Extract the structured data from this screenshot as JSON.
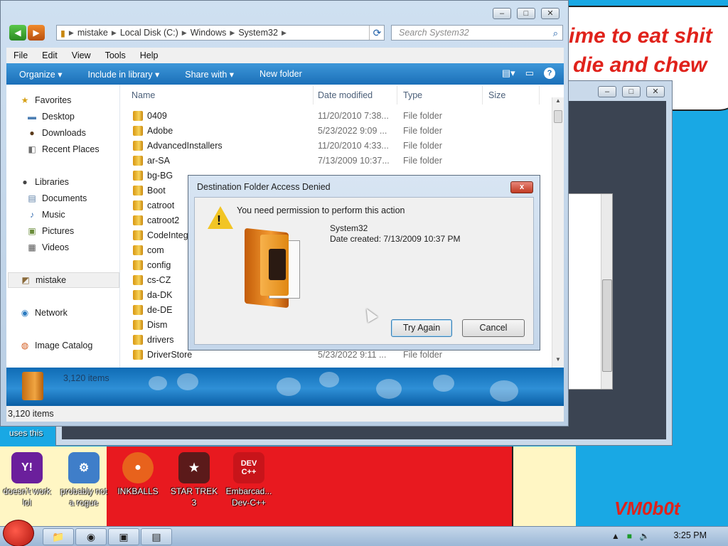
{
  "wallpaper": {
    "line1": "ime to eat shit",
    "line2": "die and chew",
    "signature": "VM0b0t",
    "uses_text": "uses this"
  },
  "explorer": {
    "address": [
      "mistake",
      "Local Disk (C:)",
      "Windows",
      "System32"
    ],
    "search_placeholder": "Search System32",
    "menu": [
      "File",
      "Edit",
      "View",
      "Tools",
      "Help"
    ],
    "toolbar": [
      "Organize ▾",
      "Include in library ▾",
      "Share with ▾",
      "New folder"
    ],
    "help": "?",
    "nav": {
      "favorites": "Favorites",
      "desktop": "Desktop",
      "downloads": "Downloads",
      "recent": "Recent Places",
      "libraries": "Libraries",
      "documents": "Documents",
      "music": "Music",
      "pictures": "Pictures",
      "videos": "Videos",
      "mistake": "mistake",
      "network": "Network",
      "image_catalog": "Image Catalog"
    },
    "columns": {
      "name": "Name",
      "date": "Date modified",
      "type": "Type",
      "size": "Size"
    },
    "rows": [
      {
        "name": "0409",
        "date": "11/20/2010 7:38...",
        "type": "File folder"
      },
      {
        "name": "Adobe",
        "date": "5/23/2022 9:09 ...",
        "type": "File folder"
      },
      {
        "name": "AdvancedInstallers",
        "date": "11/20/2010 4:33...",
        "type": "File folder"
      },
      {
        "name": "ar-SA",
        "date": "7/13/2009 10:37...",
        "type": "File folder"
      },
      {
        "name": "bg-BG",
        "date": "",
        "type": ""
      },
      {
        "name": "Boot",
        "date": "",
        "type": ""
      },
      {
        "name": "catroot",
        "date": "",
        "type": ""
      },
      {
        "name": "catroot2",
        "date": "",
        "type": ""
      },
      {
        "name": "CodeInteg",
        "date": "",
        "type": ""
      },
      {
        "name": "com",
        "date": "",
        "type": ""
      },
      {
        "name": "config",
        "date": "",
        "type": ""
      },
      {
        "name": "cs-CZ",
        "date": "",
        "type": ""
      },
      {
        "name": "da-DK",
        "date": "",
        "type": ""
      },
      {
        "name": "de-DE",
        "date": "",
        "type": ""
      },
      {
        "name": "Dism",
        "date": "",
        "type": ""
      },
      {
        "name": "drivers",
        "date": "",
        "type": ""
      },
      {
        "name": "DriverStore",
        "date": "5/23/2022 9:11 ...",
        "type": "File folder"
      }
    ],
    "details_count": "3,120 items",
    "status": "3,120 items"
  },
  "dialog": {
    "title": "Destination Folder Access Denied",
    "close": "x",
    "message": "You need permission to perform this action",
    "item_name": "System32",
    "item_date": "Date created: 7/13/2009 10:37 PM",
    "try_again": "Try Again",
    "cancel": "Cancel"
  },
  "desktop_icons": [
    {
      "label": "doesn't work lol",
      "glyph": "Y!",
      "color": "#6b1f9c"
    },
    {
      "label": "probably not a rogue",
      "glyph": "⚙",
      "color": "#3f7ec9"
    },
    {
      "label": "INKBALLS",
      "glyph": "●",
      "color": "#e8621c"
    },
    {
      "label": "STAR TREK 3",
      "glyph": "★",
      "color": "#5b1a1a"
    },
    {
      "label": "Embarcad... Dev-C++",
      "glyph": "DEV C++",
      "color": "#c8141a"
    }
  ],
  "taskbar": {
    "clock": "3:25 PM",
    "buttons": [
      "📁",
      "◉",
      "▣",
      "▤"
    ]
  }
}
